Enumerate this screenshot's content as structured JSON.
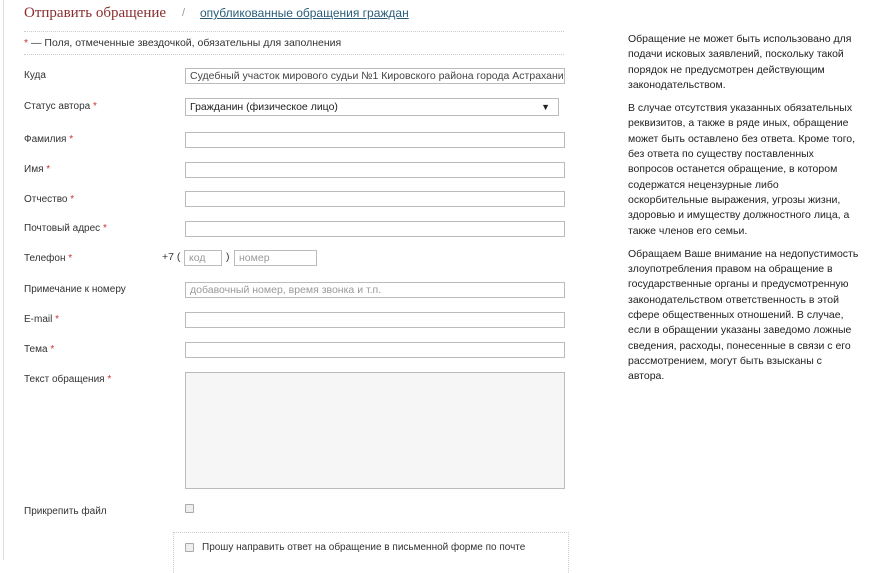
{
  "header": {
    "title": "Отправить обращение",
    "separator": "/",
    "link": "опубликованные обращения граждан"
  },
  "required_note": {
    "star": "*",
    "text": " — Поля, отмеченные звездочкой, обязательны для заполнения"
  },
  "form": {
    "to": {
      "label": "Куда",
      "value": "Судебный участок мирового судьи №1 Кировского района города Астрахани"
    },
    "author_status": {
      "label": "Статус автора",
      "value": "Гражданин (физическое лицо)"
    },
    "last_name": {
      "label": "Фамилия"
    },
    "first_name": {
      "label": "Имя"
    },
    "patronymic": {
      "label": "Отчество"
    },
    "address": {
      "label": "Почтовый адрес"
    },
    "phone": {
      "label": "Телефон",
      "prefix": "+7 (",
      "close": ")",
      "code_placeholder": "код",
      "number_placeholder": "номер"
    },
    "phone_note": {
      "label": "Примечание к номеру",
      "placeholder": "добавочный номер, время звонка и т.п."
    },
    "email": {
      "label": "E-mail"
    },
    "subject": {
      "label": "Тема"
    },
    "text": {
      "label": "Текст обращения"
    },
    "attach": {
      "label": "Прикрепить файл"
    },
    "mail_reply": {
      "label": "Прошу направить ответ на обращение в письменной форме по почте"
    },
    "star": "*"
  },
  "sidebar": {
    "paragraphs": [
      "Обращение не может быть использовано для подачи исковых заявлений, поскольку такой порядок не предусмотрен действующим законодательством.",
      "В случае отсутствия указанных обязательных реквизитов, а также в ряде иных, обращение может быть оставлено без ответа. Кроме того, без ответа по существу поставленных вопросов останется обращение, в котором содержатся нецензурные либо оскорбительные выражения, угрозы жизни, здоровью и имуществу должностного лица, а также членов его семьи.",
      "Обращаем Ваше внимание на недопустимость злоупотребления правом на обращение в государственные органы и предусмотренную законодательством ответственность в этой сфере общественных отношений. В случае, если в обращении указаны заведомо ложные сведения, расходы, понесенные в связи с его рассмотрением, могут быть взысканы с автора."
    ]
  }
}
